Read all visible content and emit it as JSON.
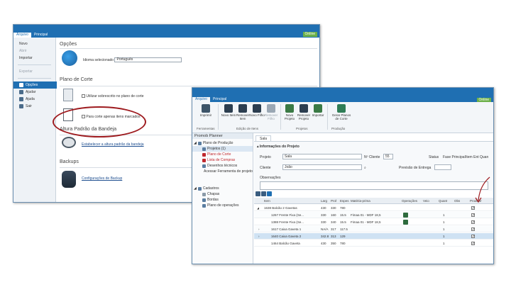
{
  "win1": {
    "tabs": [
      "Arquivo",
      "Principal"
    ],
    "online": "Online",
    "sidebar": [
      "Novo",
      "Abrir",
      "Importar",
      "Exportar",
      "Opções",
      "Ajudar",
      "Ajuda",
      "Sair"
    ],
    "options_title": "Opções",
    "language_label": "Idioma selecionado",
    "language_value": "Português",
    "plano_title": "Plano de Corte",
    "option1": "Utilizar sobrescrito no plano de corte",
    "option2": "Para corte apenas itens marcados",
    "altura_title": "Altura Padrão da Bandeja",
    "altura_link": "Estabelecer a altura padrão da bandeja",
    "backups_title": "Backups",
    "backups_link": "Configurações de Backup"
  },
  "win2": {
    "tabs": [
      "Arquivo",
      "Principal"
    ],
    "online": "Online",
    "ribbon_buttons": [
      "Imprimir",
      "Novo Item",
      "Remover Item",
      "Novo Filho",
      "Remover Filho",
      "Novo Projeto",
      "Remover Projeto",
      "Importar",
      "Gerar Planos de Corte"
    ],
    "ribbon_groups": [
      "Ferramentas",
      "Edição de Itens",
      "Projetos",
      "Produção"
    ],
    "left_title": "Promob Planner",
    "tree": [
      "Plano de Produção",
      "Projetos (1)",
      "Plano de Corte",
      "Lista de Compras",
      "Desenhos técnicos",
      "Acessar Ferramenta de projetos",
      "Cadastros",
      "Chapas",
      "Bordas",
      "Plano de operações"
    ],
    "doc_tab": "Sala",
    "info_title": "Informações do Projeto",
    "labels": {
      "projeto": "Projeto",
      "n_cliente": "Nº Cliente",
      "cliente": "Cliente",
      "previsao": "Previsão de Entrega",
      "observacoes": "Observações",
      "status": "Status",
      "fase": "Fase Principal",
      "item_ent": "Item Ent",
      "quan": "Quan"
    },
    "values": {
      "projeto": "Sala",
      "n_cliente": "55",
      "cliente": "João"
    },
    "columns": [
      "Item",
      "Larg",
      "Prof",
      "Espes",
      "Matéria-prima",
      "Operações",
      "Veio",
      "Quant",
      "Obs",
      "Produzir"
    ],
    "rows": [
      {
        "item": "1638 Balcão 2 Gavetas",
        "larg": "430",
        "prof": "330",
        "esp": "780",
        "mat": "",
        "quant": "",
        "prod": true
      },
      {
        "item": "1267 Frente Fixa (Se...",
        "larg": "330",
        "prof": "160",
        "esp": "15.5",
        "mat": "Fimaa 01 - MDF 18,5",
        "quant": "1",
        "prod": true
      },
      {
        "item": "1388 Frente Fixa (Se...",
        "larg": "330",
        "prof": "340",
        "esp": "15.5",
        "mat": "Fimaa 01 - MDF 18,5",
        "quant": "1",
        "prod": true
      },
      {
        "item": "1617 Caixa Gaveta 1",
        "larg": "NA/A",
        "prof": "317",
        "esp": "117.5",
        "mat": "",
        "quant": "1",
        "prod": true
      },
      {
        "item": "1640 Caixa Gaveta 2",
        "larg": "342.8",
        "prof": "313",
        "esp": "129",
        "mat": "",
        "quant": "1",
        "prod": true
      },
      {
        "item": "1464 Balcão Gaveta",
        "larg": "430",
        "prof": "350",
        "esp": "780",
        "mat": "",
        "quant": "1",
        "prod": true
      }
    ]
  },
  "colors": {
    "brand_blue": "#1f6fb2",
    "annotation_red": "#9e1b1f",
    "online_green": "#6cb04a"
  }
}
